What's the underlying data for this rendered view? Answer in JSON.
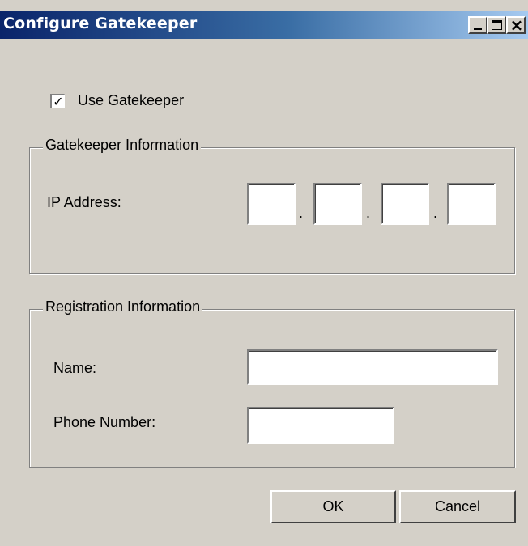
{
  "window": {
    "title": "Configure Gatekeeper",
    "controls": {
      "minimize_icon": "minimize-icon",
      "maximize_icon": "maximize-icon",
      "close_icon": "close-icon"
    }
  },
  "use_gatekeeper": {
    "label": "Use Gatekeeper",
    "checked": true
  },
  "gatekeeper_info": {
    "legend": "Gatekeeper Information",
    "ip_label": "IP Address:",
    "ip_octets": [
      "",
      "",
      "",
      ""
    ],
    "separator": "."
  },
  "registration_info": {
    "legend": "Registration Information",
    "name_label": "Name:",
    "name_value": "",
    "phone_label": "Phone Number:",
    "phone_value": ""
  },
  "buttons": {
    "ok": "OK",
    "cancel": "Cancel"
  }
}
